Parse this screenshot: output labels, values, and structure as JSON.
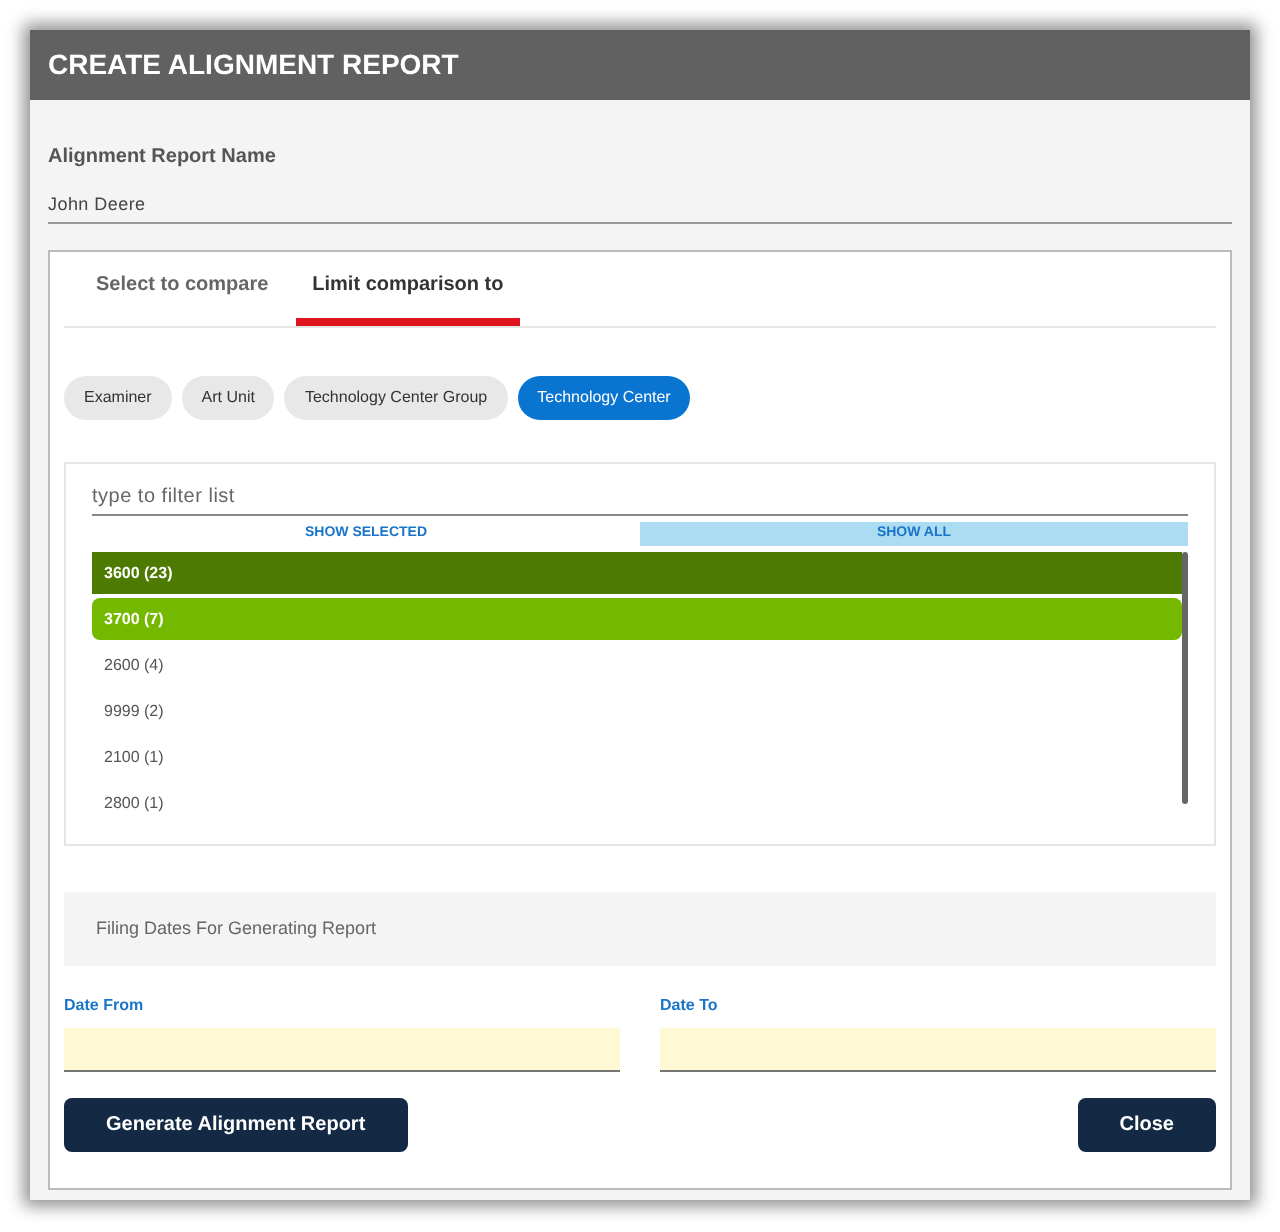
{
  "window": {
    "title": "CREATE ALIGNMENT REPORT"
  },
  "name_field": {
    "label": "Alignment Report Name",
    "value": "John Deere"
  },
  "tabs": [
    {
      "label": "Select to compare",
      "selected": false
    },
    {
      "label": "Limit comparison to",
      "selected": true
    }
  ],
  "chips": [
    {
      "label": "Examiner",
      "selected": false
    },
    {
      "label": "Art Unit",
      "selected": false
    },
    {
      "label": "Technology Center Group",
      "selected": false
    },
    {
      "label": "Technology Center",
      "selected": true
    }
  ],
  "filter": {
    "placeholder": "type to filter list"
  },
  "view_toggle": [
    {
      "label": "SHOW SELECTED",
      "selected": false
    },
    {
      "label": "SHOW ALL",
      "selected": true
    }
  ],
  "list": [
    {
      "label": "3600 (23)",
      "kind": "selected"
    },
    {
      "label": "3700 (7)",
      "kind": "hovered"
    },
    {
      "label": "2600 (4)",
      "kind": "plain"
    },
    {
      "label": "9999 (2)",
      "kind": "plain"
    },
    {
      "label": "2100 (1)",
      "kind": "plain"
    },
    {
      "label": "2800 (1)",
      "kind": "plain"
    }
  ],
  "dates_section": {
    "title": "Filing Dates For Generating Report"
  },
  "date_fields": [
    {
      "label": "Date From"
    },
    {
      "label": "Date To"
    }
  ],
  "buttons": [
    {
      "label": "Generate Alignment Report"
    },
    {
      "label": "Close"
    }
  ]
}
